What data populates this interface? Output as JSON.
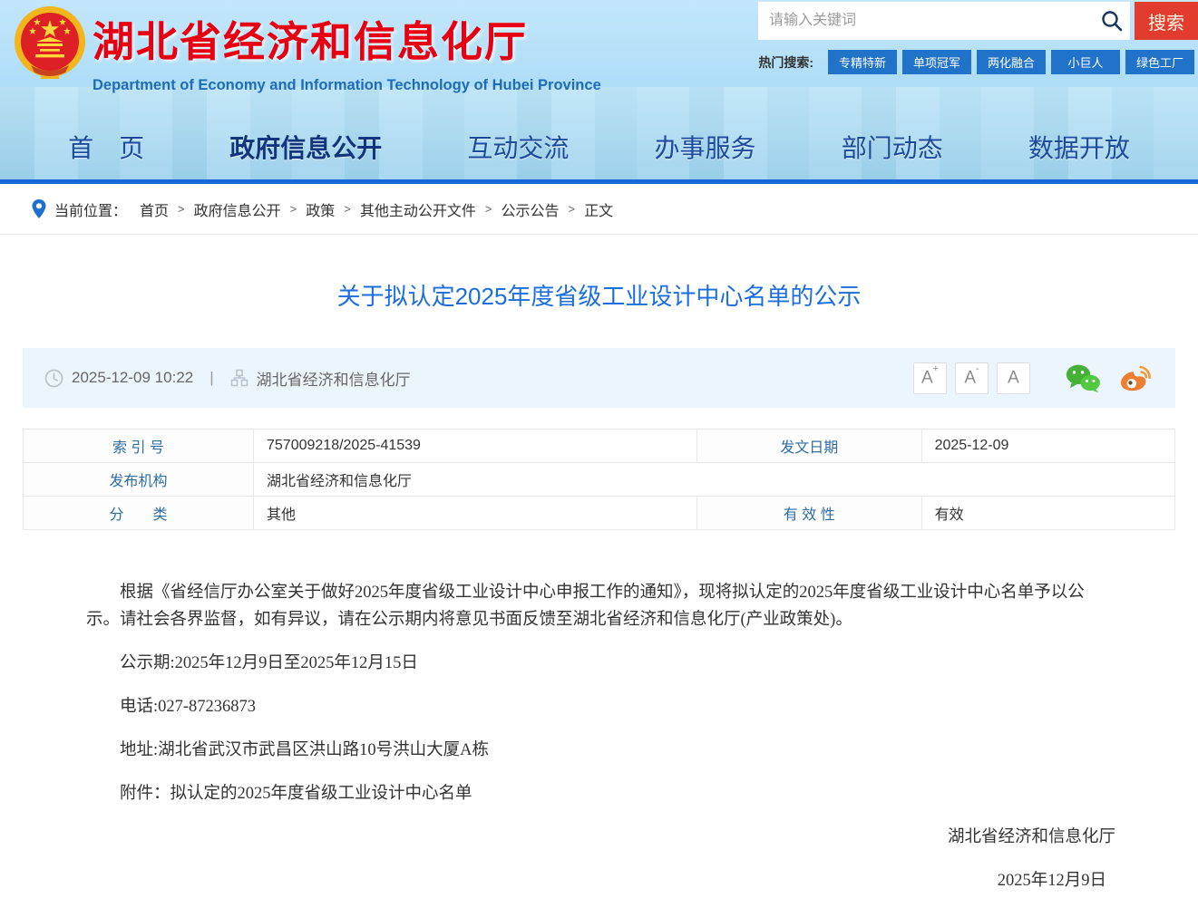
{
  "header": {
    "brand": {
      "title": "湖北省经济和信息化厅",
      "subtitle": "Department of Economy and Information Technology of Hubei Province"
    },
    "search": {
      "placeholder": "请输入关键词",
      "button": "搜索"
    },
    "hot_search": {
      "label": "热门搜索:",
      "items": [
        "专精特新",
        "单项冠军",
        "两化融合",
        "小巨人",
        "绿色工厂"
      ]
    },
    "nav": {
      "items": [
        {
          "label": "首　页",
          "active": false
        },
        {
          "label": "政府信息公开",
          "active": true
        },
        {
          "label": "互动交流",
          "active": false
        },
        {
          "label": "办事服务",
          "active": false
        },
        {
          "label": "部门动态",
          "active": false
        },
        {
          "label": "数据开放",
          "active": false
        }
      ]
    }
  },
  "breadcrumb": {
    "label": "当前位置：",
    "separator": ">",
    "items": [
      "首页",
      "政府信息公开",
      "政策",
      "其他主动公开文件",
      "公示公告",
      "正文"
    ]
  },
  "article": {
    "title": "关于拟认定2025年度省级工业设计中心名单的公示",
    "meta": {
      "datetime": "2025-12-09 10:22",
      "divider": "|",
      "source": "湖北省经济和信息化厅",
      "font_controls": [
        {
          "base": "A",
          "sign": "+"
        },
        {
          "base": "A",
          "sign": "-"
        },
        {
          "base": "A",
          "sign": ""
        }
      ]
    },
    "info_table": {
      "index_label": "索 引 号",
      "index_value": "757009218/2025-41539",
      "issue_date_label": "发文日期",
      "issue_date_value": "2025-12-09",
      "issuer_label": "发布机构",
      "issuer_value": "湖北省经济和信息化厅",
      "category_label": "分　　类",
      "category_value": "其他",
      "validity_label": "有 效 性",
      "validity_value": "有效"
    },
    "paragraphs": [
      "根据《省经信厅办公室关于做好2025年度省级工业设计中心申报工作的通知》，现将拟认定的2025年度省级工业设计中心名单予以公示。请社会各界监督，如有异议，请在公示期内将意见书面反馈至湖北省经济和信息化厅(产业政策处)。",
      "公示期:2025年12月9日至2025年12月15日",
      "电话:027-87236873",
      "地址:湖北省武汉市武昌区洪山路10号洪山大厦A栋"
    ],
    "attachment": "附件：拟认定的2025年度省级工业设计中心名单",
    "signature": {
      "org": "湖北省经济和信息化厅",
      "date": "2025年12月9日"
    }
  },
  "colors": {
    "brand_red": "#e60012",
    "title_blue": "#1a6ede",
    "search_button_red": "#e23c2e",
    "hot_button_blue": "#2173c9",
    "nav_strip_blue": "#1767d8",
    "table_label_blue": "#2e6da4",
    "wechat_green": "#45b035",
    "weibo_orange": "#ed7d31"
  }
}
